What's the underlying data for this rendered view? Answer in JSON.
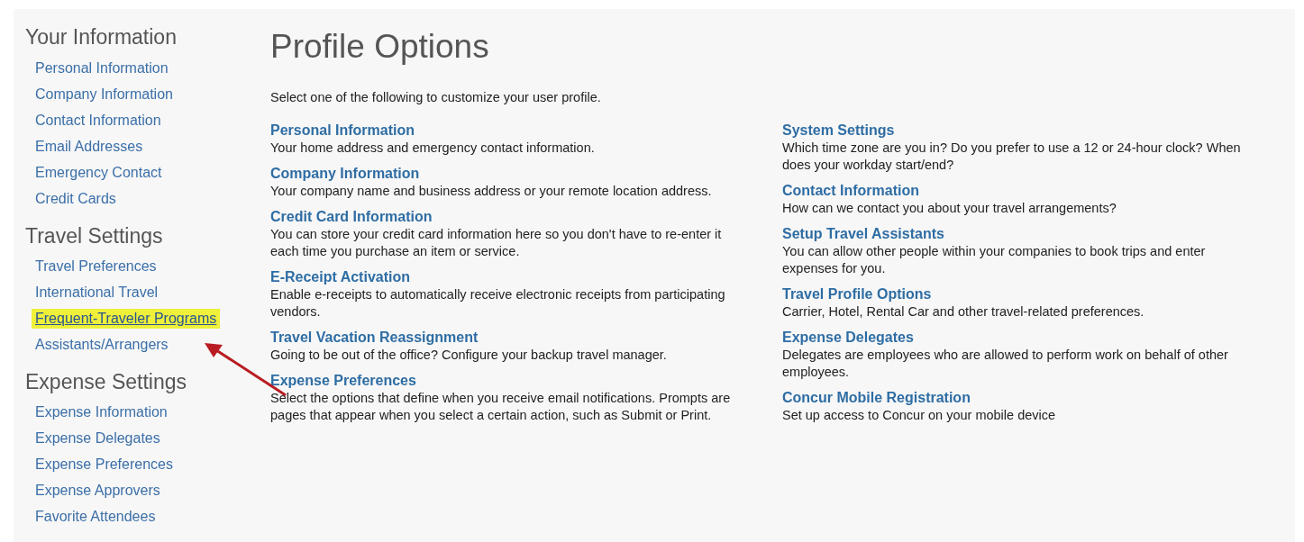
{
  "sidebar": [
    {
      "heading": "Your Information",
      "items": [
        {
          "label": "Personal Information",
          "highlighted": false
        },
        {
          "label": "Company Information",
          "highlighted": false
        },
        {
          "label": "Contact Information",
          "highlighted": false
        },
        {
          "label": "Email Addresses",
          "highlighted": false
        },
        {
          "label": "Emergency Contact",
          "highlighted": false
        },
        {
          "label": "Credit Cards",
          "highlighted": false
        }
      ]
    },
    {
      "heading": "Travel Settings",
      "items": [
        {
          "label": "Travel Preferences",
          "highlighted": false
        },
        {
          "label": "International Travel",
          "highlighted": false
        },
        {
          "label": "Frequent-Traveler Programs",
          "highlighted": true
        },
        {
          "label": "Assistants/Arrangers",
          "highlighted": false
        }
      ]
    },
    {
      "heading": "Expense Settings",
      "items": [
        {
          "label": "Expense Information",
          "highlighted": false
        },
        {
          "label": "Expense Delegates",
          "highlighted": false
        },
        {
          "label": "Expense Preferences",
          "highlighted": false
        },
        {
          "label": "Expense Approvers",
          "highlighted": false
        },
        {
          "label": "Favorite Attendees",
          "highlighted": false
        }
      ]
    }
  ],
  "title": "Profile Options",
  "intro": "Select one of the following to customize your user profile.",
  "columns": [
    [
      {
        "title": "Personal Information",
        "description": "Your home address and emergency contact information."
      },
      {
        "title": "Company Information",
        "description": "Your company name and business address or your remote location address."
      },
      {
        "title": "Credit Card Information",
        "description": "You can store your credit card information here so you don't have to re-enter it each time you purchase an item or service."
      },
      {
        "title": "E-Receipt Activation",
        "description": "Enable e-receipts to automatically receive electronic receipts from participating vendors."
      },
      {
        "title": "Travel Vacation Reassignment",
        "description": "Going to be out of the office? Configure your backup travel manager."
      },
      {
        "title": "Expense Preferences",
        "description": "Select the options that define when you receive email notifications. Prompts are pages that appear when you select a certain action, such as Submit or Print."
      }
    ],
    [
      {
        "title": "System Settings",
        "description": "Which time zone are you in? Do you prefer to use a 12 or 24-hour clock? When does your workday start/end?"
      },
      {
        "title": "Contact Information",
        "description": "How can we contact you about your travel arrangements?"
      },
      {
        "title": "Setup Travel Assistants",
        "description": "You can allow other people within your companies to book trips and enter expenses for you."
      },
      {
        "title": "Travel Profile Options",
        "description": "Carrier, Hotel, Rental Car and other travel-related preferences."
      },
      {
        "title": "Expense Delegates",
        "description": "Delegates are employees who are allowed to perform work on behalf of other employees."
      },
      {
        "title": "Concur Mobile Registration",
        "description": "Set up access to Concur on your mobile device"
      }
    ]
  ]
}
